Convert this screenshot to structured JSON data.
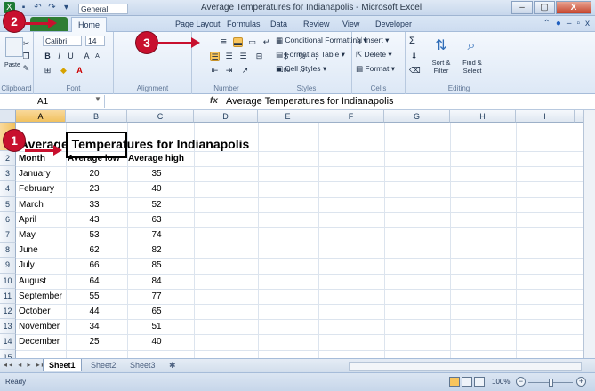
{
  "window": {
    "title": "Average Temperatures for Indianapolis - Microsoft Excel",
    "controls": [
      "–",
      "▢",
      "X"
    ]
  },
  "ribbon": {
    "tabs": [
      "Home",
      "Page Layout",
      "Formulas",
      "Data",
      "Review",
      "View",
      "Developer"
    ],
    "active_tab": "Home",
    "clipboard": {
      "paste": "Paste",
      "label": "Clipboard"
    },
    "font": {
      "name": "Calibri",
      "size": "14",
      "label": "Font"
    },
    "alignment": {
      "label": "Alignment"
    },
    "number": {
      "format": "General",
      "currency": "$",
      "percent": "%",
      "comma": ",",
      "dec_more": ".00",
      "dec_less": ".0",
      "label": "Number"
    },
    "styles": {
      "conditional": "Conditional Formatting",
      "format_table": "Format as Table",
      "cell_styles": "Cell Styles",
      "label": "Styles"
    },
    "cells": {
      "insert": "Insert",
      "delete": "Delete",
      "format": "Format",
      "label": "Cells"
    },
    "editing": {
      "sort": "Sort & Filter",
      "find": "Find & Select",
      "sigma": "Σ",
      "label": "Editing"
    }
  },
  "formula_bar": {
    "name_box": "A1",
    "fx": "fx",
    "value": "Average Temperatures for Indianapolis"
  },
  "sheet": {
    "columns": [
      "A",
      "B",
      "C",
      "D",
      "E",
      "F",
      "G",
      "H",
      "I",
      "J"
    ],
    "title": "Average Temperatures for Indianapolis",
    "header": {
      "month": "Month",
      "low": "Average low",
      "high": "Average high"
    },
    "rows": [
      {
        "month": "January",
        "low": "20",
        "high": "35"
      },
      {
        "month": "February",
        "low": "23",
        "high": "40"
      },
      {
        "month": "March",
        "low": "33",
        "high": "52"
      },
      {
        "month": "April",
        "low": "43",
        "high": "63"
      },
      {
        "month": "May",
        "low": "53",
        "high": "74"
      },
      {
        "month": "June",
        "low": "62",
        "high": "82"
      },
      {
        "month": "July",
        "low": "66",
        "high": "85"
      },
      {
        "month": "August",
        "low": "64",
        "high": "84"
      },
      {
        "month": "September",
        "low": "55",
        "high": "77"
      },
      {
        "month": "October",
        "low": "44",
        "high": "65"
      },
      {
        "month": "November",
        "low": "34",
        "high": "51"
      },
      {
        "month": "December",
        "low": "25",
        "high": "40"
      }
    ],
    "row_numbers": [
      "1",
      "2",
      "3",
      "4",
      "5",
      "6",
      "7",
      "8",
      "9",
      "10",
      "11",
      "12",
      "13",
      "14",
      "15"
    ]
  },
  "sheet_tabs": [
    "Sheet1",
    "Sheet2",
    "Sheet3"
  ],
  "status": {
    "mode": "Ready",
    "zoom": "100%"
  },
  "callouts": [
    "1",
    "2",
    "3"
  ],
  "colors": {
    "accent": "#c8102e",
    "file_tab": "#2e7d33",
    "selection": "#f8c55d"
  }
}
